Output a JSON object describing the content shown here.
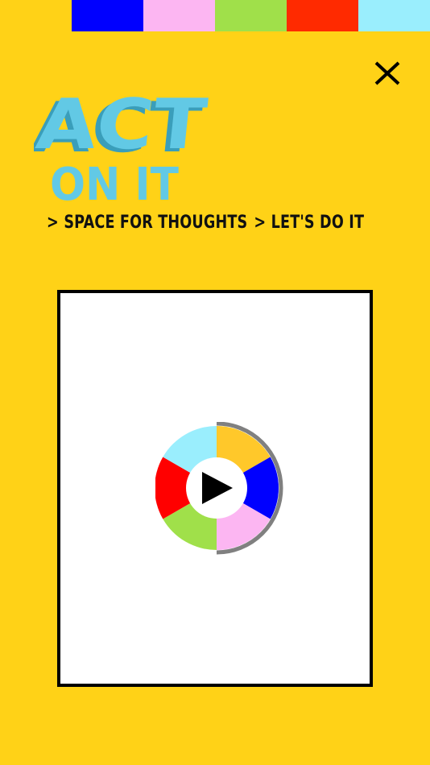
{
  "color_strip": {
    "swatches": [
      "#0000FF",
      "#FCB6F2",
      "#A0E04A",
      "#FF2A00",
      "#9AEEFD"
    ]
  },
  "colors": {
    "background": "#FFD217",
    "title": "#62C9E5",
    "title_shadow": "#3A9EBA",
    "text": "#111111",
    "frame_border": "#000000"
  },
  "header": {
    "close_icon": "close-icon"
  },
  "title": {
    "line1": "ACT",
    "line2": "ON IT"
  },
  "breadcrumb": {
    "separator": ">",
    "items": [
      "SPACE FOR THOUGHTS",
      "LET'S DO IT"
    ]
  },
  "video": {
    "play_icon": "play-icon",
    "wheel_colors": [
      "#FFC82A",
      "#0000FF",
      "#FCB6F2",
      "#A0E04A",
      "#FF0000",
      "#9AEEFD"
    ],
    "progress": 0.5
  }
}
